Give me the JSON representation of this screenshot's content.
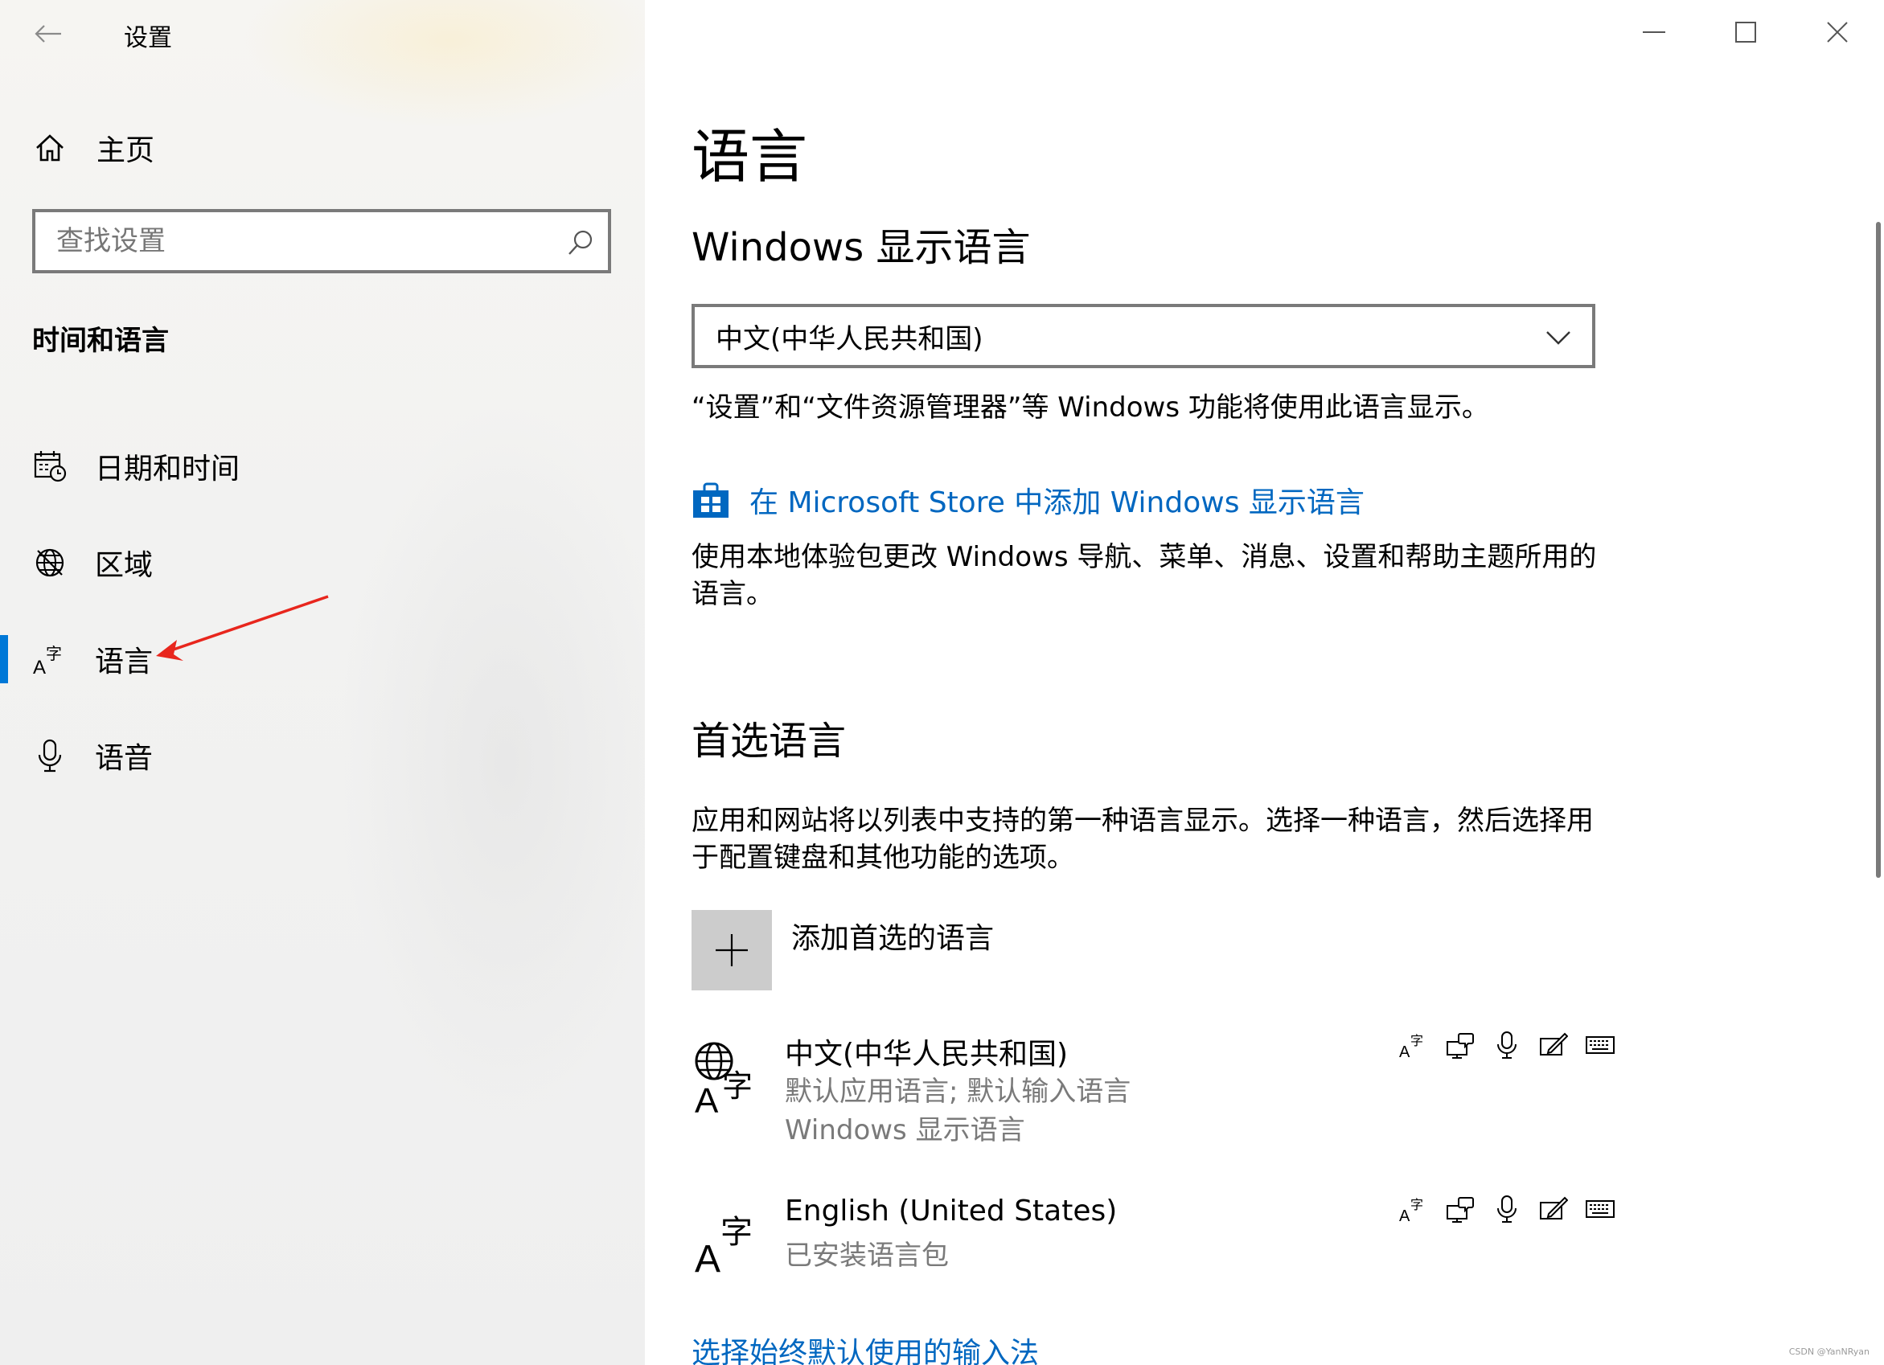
{
  "window": {
    "title": "设置",
    "caption": {
      "minimize": "minimize",
      "maximize": "maximize",
      "close": "close"
    }
  },
  "sidebar": {
    "home_label": "主页",
    "search_placeholder": "查找设置",
    "section_title": "时间和语言",
    "items": [
      {
        "label": "日期和时间",
        "icon": "calendar-clock-icon",
        "active": false
      },
      {
        "label": "区域",
        "icon": "globe-region-icon",
        "active": false
      },
      {
        "label": "语言",
        "icon": "language-icon",
        "active": true
      },
      {
        "label": "语音",
        "icon": "microphone-icon",
        "active": false
      }
    ]
  },
  "content": {
    "page_title": "语言",
    "display_heading": "Windows 显示语言",
    "display_dropdown_value": "中文(中华人民共和国)",
    "display_desc": "“设置”和“文件资源管理器”等 Windows 功能将使用此语言显示。",
    "store_link": "在 Microsoft Store 中添加 Windows 显示语言",
    "store_desc": "使用本地体验包更改 Windows 导航、菜单、消息、设置和帮助主题所用的语言。",
    "preferred_heading": "首选语言",
    "preferred_desc": "应用和网站将以列表中支持的第一种语言显示。选择一种语言，然后选择用于配置键盘和其他功能的选项。",
    "add_language_label": "添加首选的语言",
    "languages": [
      {
        "name": "中文(中华人民共和国)",
        "sub1": "默认应用语言; 默认输入语言",
        "sub2": "Windows 显示语言"
      },
      {
        "name": "English (United States)",
        "sub1": "已安装语言包"
      }
    ],
    "feature_icons": [
      "display-language-icon",
      "speech-bubble-display-icon",
      "microphone-icon",
      "handwriting-icon",
      "keyboard-icon"
    ],
    "bottom_link": "选择始终默认使用的输入法"
  },
  "watermark": "CSDN @YanNRyan",
  "colors": {
    "accent": "#0078d7",
    "link": "#0067c0",
    "sidebar_bg": "#f2f2f1"
  }
}
